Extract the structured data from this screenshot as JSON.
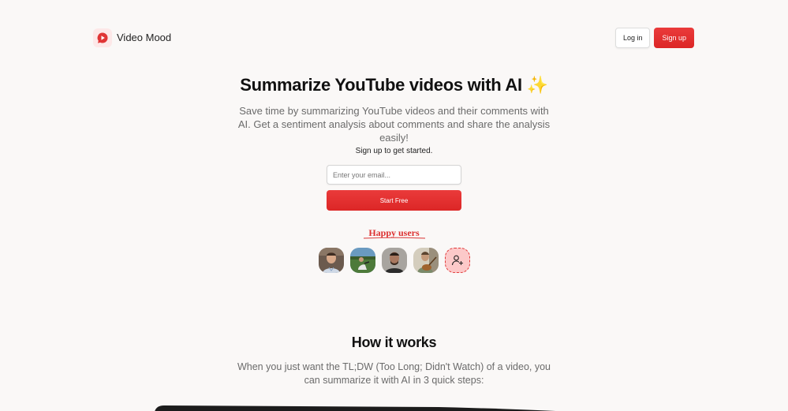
{
  "brand": {
    "name": "Video Mood",
    "icon": "play-bubble-icon",
    "accent": "#dc2626"
  },
  "header": {
    "login_label": "Log in",
    "signup_label": "Sign up"
  },
  "hero": {
    "title": "Summarize YouTube videos with AI ✨",
    "subtitle": "Save time by summarizing YouTube videos and their comments with AI. Get a sentiment analysis about comments and share the analysis easily!"
  },
  "cta": {
    "label": "Sign up to get started.",
    "email_placeholder": "Enter your email...",
    "start_label": "Start Free"
  },
  "social": {
    "title": "Happy users",
    "avatars": [
      "user-avatar-1",
      "user-avatar-2",
      "user-avatar-3",
      "user-avatar-4"
    ],
    "add_icon": "add-user-icon"
  },
  "how": {
    "title": "How it works",
    "subtitle": "When you just want the TL;DW (Too Long; Didn't Watch) of a video, you can summarize it with AI in 3 quick steps:"
  }
}
